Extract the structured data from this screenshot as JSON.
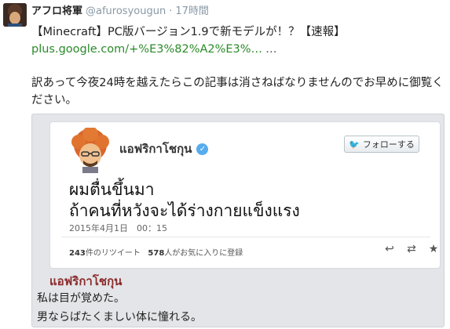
{
  "post": {
    "author_name": "アフロ将軍",
    "author_handle": "@afurosyougun",
    "separator": "·",
    "time": "17時間",
    "title": "【Minecraft】PC版バージョン1.9で新モデルが！？【速報】",
    "link_text": "plus.google.com/+%E3%82%A2%E3%…",
    "link_more": "…",
    "body": "訳あって今夜24時を越えたらこの記事は消さねばなりませんのでお早めに御覧ください。"
  },
  "embed": {
    "card": {
      "display_name": "แอฟริกาโชกุน",
      "verified_icon": "verified-check-icon",
      "follow_icon": "twitter-bird-icon",
      "follow_label": "フォローする",
      "tweet_line1": "ผมตื่นขึ้นมา",
      "tweet_line2": "ถ้าคนที่หวังจะได้ร่างกายแข็งแรง",
      "date": "2015年4月1日　00：15",
      "retweet_count": "243",
      "retweet_label": "件のリツイート",
      "favorite_count": "578",
      "favorite_label": "人がお気に入りに登録",
      "action_icons": [
        "reply-icon",
        "retweet-icon",
        "favorite-star-icon"
      ]
    },
    "caption_name": "แอฟริกาโชกุน",
    "caption_line1": "私は目が覚めた。",
    "caption_line2": "男ならばたくましい体に憧れる。"
  },
  "colors": {
    "link": "#2a8a2a",
    "verified": "#55acee",
    "caption_name": "#8a2a2a"
  }
}
